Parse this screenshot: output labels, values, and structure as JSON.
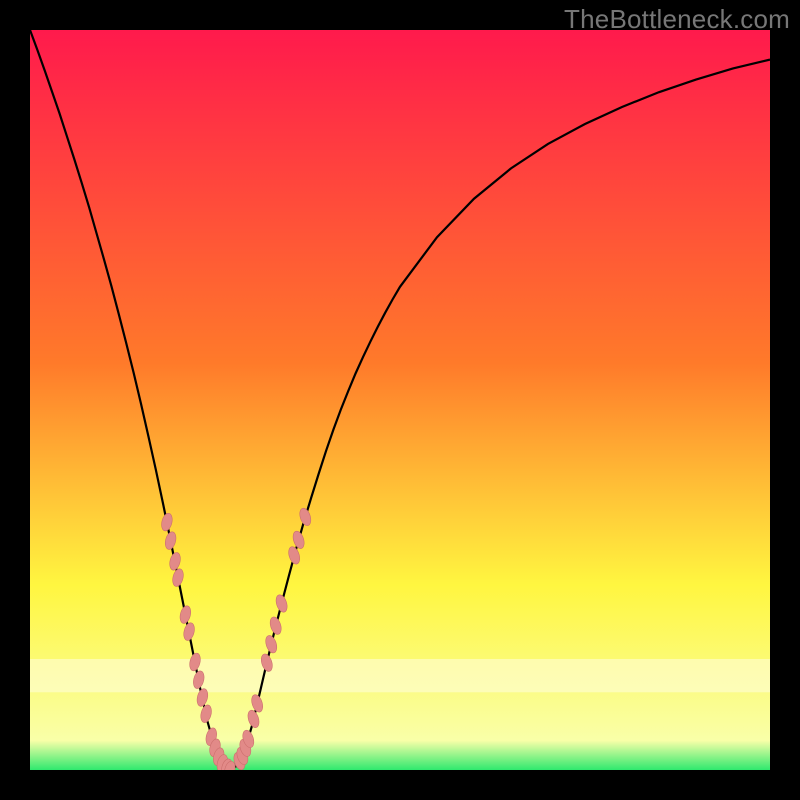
{
  "watermark": {
    "text": "TheBottleneck.com"
  },
  "colors": {
    "frame": "#000000",
    "gradient_top": "#ff1a4c",
    "gradient_mid1": "#ff7a2a",
    "gradient_mid2": "#fff640",
    "gradient_band": "#f9ffa8",
    "gradient_bottom": "#2fe96e",
    "curve": "#000000",
    "marker_fill": "#e28a88",
    "marker_stroke": "#cc6f6d"
  },
  "chart_data": {
    "type": "line",
    "title": "",
    "xlabel": "",
    "ylabel": "",
    "legend": false,
    "grid": false,
    "xlim": [
      0,
      100
    ],
    "ylim": [
      0,
      100
    ],
    "x": [
      0,
      1,
      2,
      3,
      4,
      5,
      6,
      7,
      8,
      9,
      10,
      11,
      12,
      13,
      14,
      15,
      16,
      17,
      18,
      19,
      20,
      21,
      22,
      23,
      24,
      25,
      26,
      27,
      28,
      29,
      30,
      31,
      32,
      33,
      34,
      35,
      36,
      37,
      38,
      39,
      40,
      41,
      42,
      43,
      44,
      45,
      46,
      47,
      48,
      49,
      50,
      55,
      60,
      65,
      70,
      75,
      80,
      85,
      90,
      95,
      100
    ],
    "y": [
      100,
      97.3,
      94.5,
      91.6,
      88.7,
      85.6,
      82.5,
      79.3,
      76.0,
      72.5,
      69.0,
      65.4,
      61.6,
      57.7,
      53.7,
      49.5,
      45.1,
      40.6,
      35.9,
      31.0,
      26.0,
      21.0,
      16.0,
      11.0,
      6.5,
      3.0,
      0.7,
      0.0,
      0.6,
      2.5,
      6.0,
      10.2,
      14.5,
      18.6,
      22.5,
      26.3,
      30.0,
      33.5,
      36.8,
      40.0,
      43.1,
      46.0,
      48.7,
      51.2,
      53.6,
      55.8,
      57.9,
      59.9,
      61.8,
      63.6,
      65.3,
      72.0,
      77.2,
      81.3,
      84.6,
      87.3,
      89.6,
      91.6,
      93.3,
      94.8,
      96.0
    ],
    "markers_left": [
      {
        "x": 18.5,
        "y": 33.5
      },
      {
        "x": 19.0,
        "y": 31.0
      },
      {
        "x": 19.6,
        "y": 28.2
      },
      {
        "x": 20.0,
        "y": 26.0
      },
      {
        "x": 21.0,
        "y": 21.0
      },
      {
        "x": 21.5,
        "y": 18.7
      },
      {
        "x": 22.3,
        "y": 14.6
      },
      {
        "x": 22.8,
        "y": 12.2
      },
      {
        "x": 23.3,
        "y": 9.8
      },
      {
        "x": 23.8,
        "y": 7.6
      },
      {
        "x": 24.5,
        "y": 4.5
      },
      {
        "x": 25.0,
        "y": 3.0
      },
      {
        "x": 25.5,
        "y": 1.8
      },
      {
        "x": 26.0,
        "y": 0.9
      },
      {
        "x": 26.6,
        "y": 0.3
      },
      {
        "x": 27.0,
        "y": 0.0
      }
    ],
    "markers_right": [
      {
        "x": 28.3,
        "y": 1.2
      },
      {
        "x": 28.7,
        "y": 1.9
      },
      {
        "x": 29.1,
        "y": 3.0
      },
      {
        "x": 29.5,
        "y": 4.2
      },
      {
        "x": 30.2,
        "y": 6.9
      },
      {
        "x": 30.7,
        "y": 9.0
      },
      {
        "x": 32.0,
        "y": 14.5
      },
      {
        "x": 32.6,
        "y": 17.0
      },
      {
        "x": 33.2,
        "y": 19.5
      },
      {
        "x": 34.0,
        "y": 22.5
      },
      {
        "x": 35.7,
        "y": 29.0
      },
      {
        "x": 36.3,
        "y": 31.1
      },
      {
        "x": 37.2,
        "y": 34.2
      }
    ],
    "horizontal_bands": [
      {
        "y0": 10.5,
        "y1": 15.0,
        "opacity": 0.55
      }
    ]
  }
}
